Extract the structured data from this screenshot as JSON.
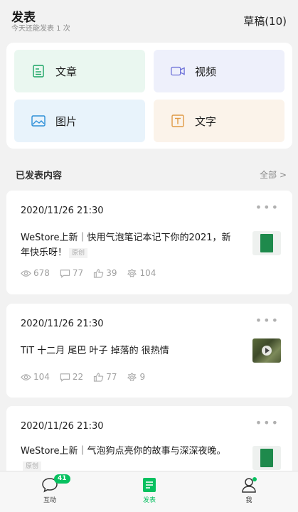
{
  "header": {
    "title": "发表",
    "subtitle": "今天还能发表 1 次",
    "drafts": "草稿(10)"
  },
  "create": {
    "article": "文章",
    "video": "视频",
    "image": "图片",
    "text": "文字"
  },
  "published": {
    "title": "已发表内容",
    "all": "全部 >"
  },
  "posts": [
    {
      "time": "2020/11/26 21:30",
      "text": "WeStore上新｜快用气泡笔记本记下你的2021，新年快乐呀！",
      "badge": "原创",
      "views": "678",
      "comments": "77",
      "likes": "39",
      "shares": "104",
      "thumb": "green-notebook"
    },
    {
      "time": "2020/11/26 21:30",
      "text": "TiT 十二月 尾巴 叶子 掉落的 很热情",
      "views": "104",
      "comments": "22",
      "likes": "77",
      "shares": "9",
      "thumb": "video-photo"
    },
    {
      "time": "2020/11/26 21:30",
      "text": "WeStore上新｜气泡狗点亮你的故事与深深夜晚。",
      "badge": "原创",
      "thumb": "green-notebook"
    }
  ],
  "tabbar": {
    "hudong": "互动",
    "hudong_badge": "41",
    "fabiao": "发表",
    "me": "我"
  },
  "colors": {
    "accent": "#07c160"
  }
}
